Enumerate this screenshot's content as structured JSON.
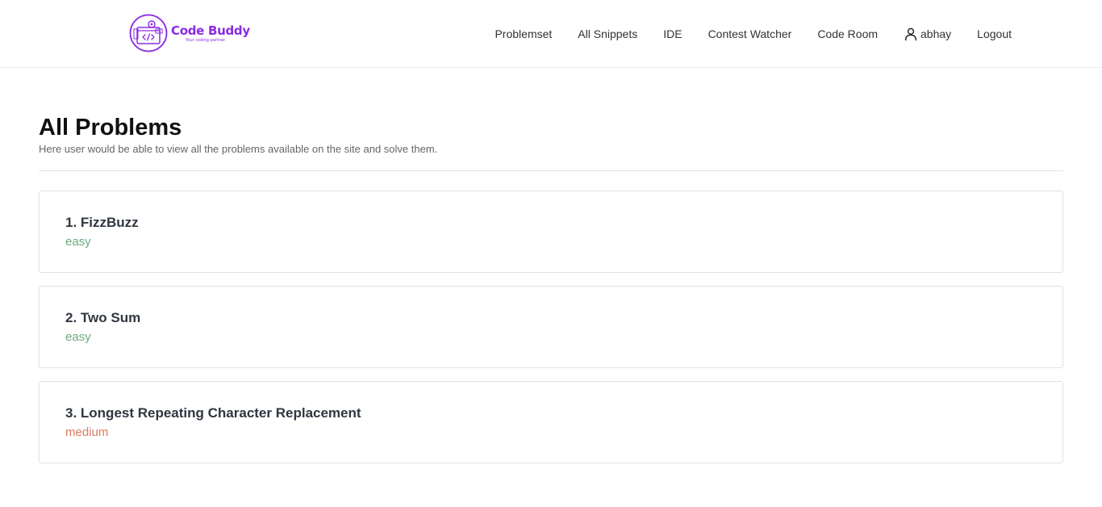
{
  "brand": {
    "title": "Code Buddy",
    "tagline": "Your coding partner.",
    "logo_icon": "code-window-gear-icon",
    "color": "#8a2be2"
  },
  "nav": {
    "items": [
      {
        "label": "Problemset"
      },
      {
        "label": "All Snippets"
      },
      {
        "label": "IDE"
      },
      {
        "label": "Contest Watcher"
      },
      {
        "label": "Code Room"
      }
    ],
    "user": {
      "icon": "user-icon",
      "label": "abhay"
    },
    "logout": {
      "label": "Logout"
    }
  },
  "page": {
    "title": "All Problems",
    "subtitle": "Here user would be able to view all the problems available on the site and solve them."
  },
  "problems": [
    {
      "title": "1. FizzBuzz",
      "difficulty": "easy",
      "difficulty_color": "#6aaa7d"
    },
    {
      "title": "2. Two Sum",
      "difficulty": "easy",
      "difficulty_color": "#6aaa7d"
    },
    {
      "title": "3. Longest Repeating Character Replacement",
      "difficulty": "medium",
      "difficulty_color": "#e07a5f"
    }
  ]
}
